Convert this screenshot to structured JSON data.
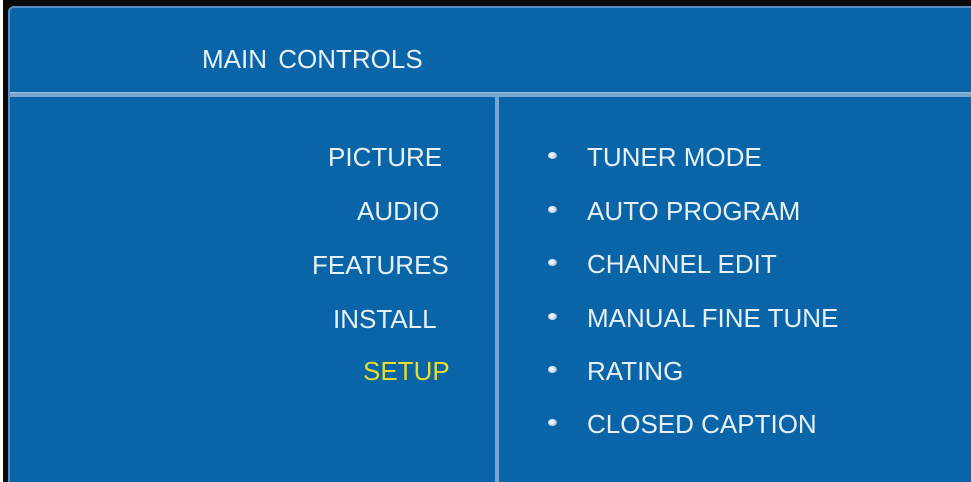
{
  "header": {
    "title": "MAIN  CONTROLS"
  },
  "left_menu": {
    "items": [
      {
        "label": "PICTURE",
        "active": false
      },
      {
        "label": "AUDIO",
        "active": false
      },
      {
        "label": "FEATURES",
        "active": false
      },
      {
        "label": "INSTALL",
        "active": false
      },
      {
        "label": "SETUP",
        "active": true
      }
    ]
  },
  "right_menu": {
    "items": [
      {
        "label": "TUNER MODE"
      },
      {
        "label": "AUTO PROGRAM"
      },
      {
        "label": "CHANNEL EDIT"
      },
      {
        "label": "MANUAL FINE TUNE"
      },
      {
        "label": "RATING"
      },
      {
        "label": "CLOSED CAPTION"
      }
    ]
  },
  "colors": {
    "panel_background": "#0964a8",
    "text": "#e8f0f8",
    "active_text": "#e6dc2a",
    "divider": "#7aa6cf"
  }
}
